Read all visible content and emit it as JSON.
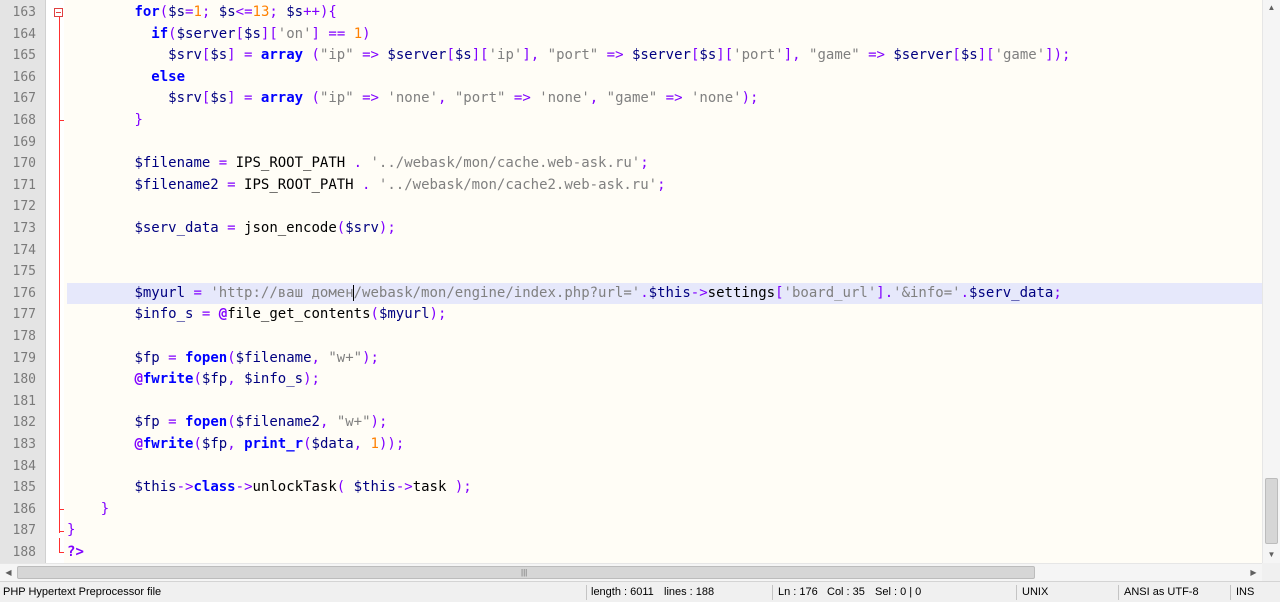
{
  "editor": {
    "current_line": 176,
    "lines": [
      {
        "n": "163",
        "t": "for($s=1; $s<=13; $s++){"
      },
      {
        "n": "164",
        "t": "  if($server[$s]['on'] == 1)"
      },
      {
        "n": "165",
        "t": "    $srv[$s] = array (\"ip\" => $server[$s]['ip'], \"port\" => $server[$s]['port'], \"game\" => $server[$s]['game']);"
      },
      {
        "n": "166",
        "t": "  else"
      },
      {
        "n": "167",
        "t": "    $srv[$s] = array (\"ip\" => 'none', \"port\" => 'none', \"game\" => 'none');"
      },
      {
        "n": "168",
        "t": "}"
      },
      {
        "n": "169",
        "t": ""
      },
      {
        "n": "170",
        "t": "$filename = IPS_ROOT_PATH . '../webask/mon/cache.web-ask.ru';"
      },
      {
        "n": "171",
        "t": "$filename2 = IPS_ROOT_PATH . '../webask/mon/cache2.web-ask.ru';"
      },
      {
        "n": "172",
        "t": ""
      },
      {
        "n": "173",
        "t": "$serv_data = json_encode($srv);"
      },
      {
        "n": "174",
        "t": ""
      },
      {
        "n": "175",
        "t": ""
      },
      {
        "n": "176",
        "t": "$myurl = 'http://ваш домен/webask/mon/engine/index.php?url='.$this->settings['board_url'].'&info='.$serv_data;"
      },
      {
        "n": "177",
        "t": "$info_s = @file_get_contents($myurl);"
      },
      {
        "n": "178",
        "t": ""
      },
      {
        "n": "179",
        "t": "$fp = fopen($filename, \"w+\");"
      },
      {
        "n": "180",
        "t": "@fwrite($fp, $info_s);"
      },
      {
        "n": "181",
        "t": ""
      },
      {
        "n": "182",
        "t": "$fp = fopen($filename2, \"w+\");"
      },
      {
        "n": "183",
        "t": "@fwrite($fp, print_r($data, 1));"
      },
      {
        "n": "184",
        "t": ""
      },
      {
        "n": "185",
        "t": "$this->class->unlockTask( $this->task );"
      },
      {
        "n": "186",
        "t": "}"
      },
      {
        "n": "187",
        "t": "}"
      },
      {
        "n": "188",
        "t": "?>"
      }
    ]
  },
  "statusbar": {
    "file_type": "PHP Hypertext Preprocessor file",
    "length": "length : 6011",
    "lines": "lines : 188",
    "ln": "Ln : 176",
    "col": "Col : 35",
    "sel": "Sel : 0 | 0",
    "eol": "UNIX",
    "encoding": "ANSI as UTF-8",
    "mode": "INS"
  },
  "colors": {
    "keyword": "#0000ff",
    "variable": "#000080",
    "string": "#808080",
    "number": "#ff8000",
    "operator": "#8000ff",
    "fold_line": "#ff3030",
    "current_line_bg": "#e6e8fb"
  },
  "icons": {
    "fold_marker": "fold-minus-icon",
    "scroll_up": "arrow-up-icon",
    "scroll_down": "arrow-down-icon",
    "scroll_left": "arrow-left-icon",
    "scroll_right": "arrow-right-icon"
  }
}
